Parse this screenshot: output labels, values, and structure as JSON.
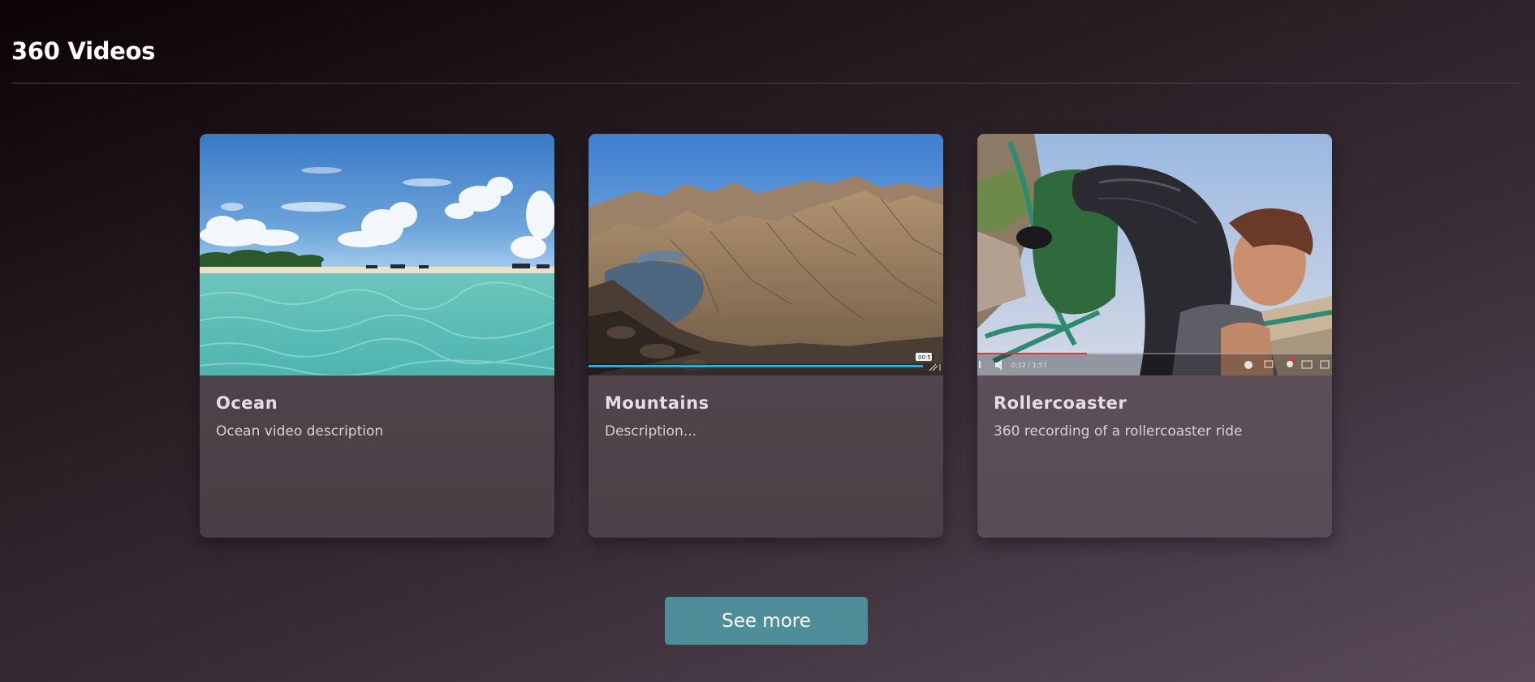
{
  "page": {
    "title": "360 Videos"
  },
  "videos": [
    {
      "title": "Ocean",
      "description": "Ocean video description",
      "thumbnail_icon": "ocean-beach-thumbnail"
    },
    {
      "title": "Mountains",
      "description": "Description...",
      "thumbnail_icon": "mountain-lake-thumbnail",
      "player_time_badge": "00:51"
    },
    {
      "title": "Rollercoaster",
      "description": "360 recording of a rollercoaster ride",
      "thumbnail_icon": "rollercoaster-thumbnail",
      "player_time": "0:12 / 1:57"
    }
  ],
  "actions": {
    "see_more_label": "See more"
  },
  "colors": {
    "button": "#4f8e98",
    "card": "#4f434a",
    "divider": "#4b4247"
  }
}
